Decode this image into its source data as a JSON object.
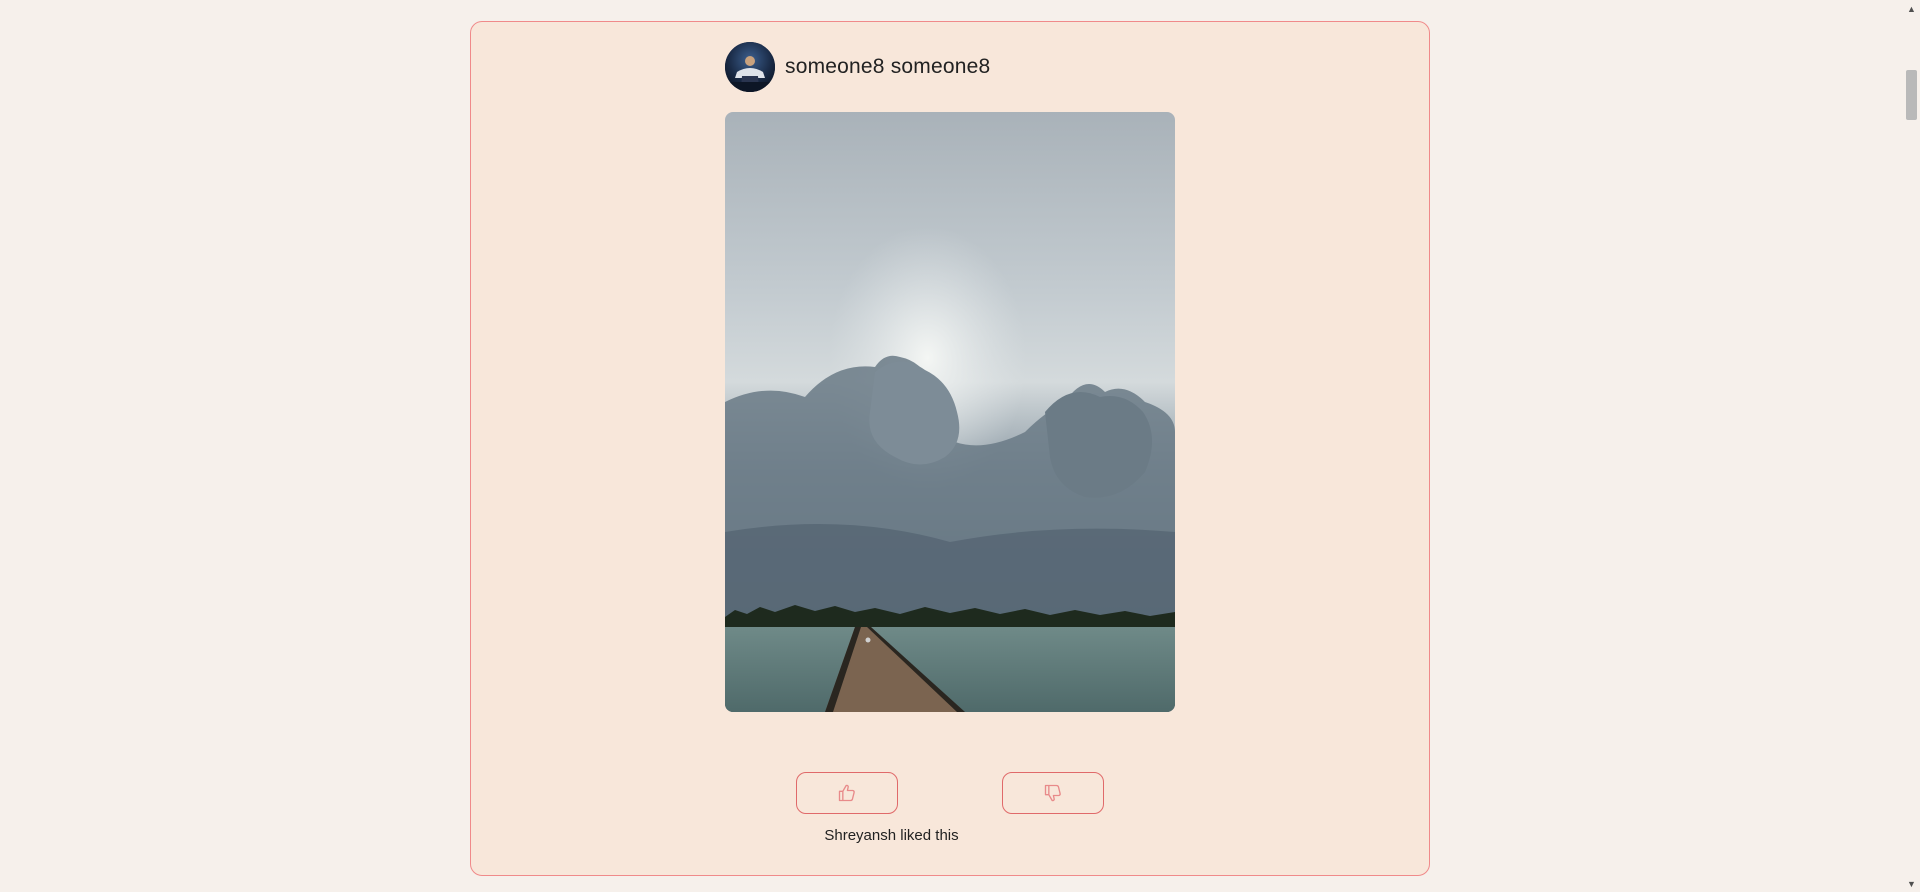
{
  "post": {
    "author": "someone8 someone8",
    "avatar_icon": "user-avatar",
    "photo_icon": "landscape-photo",
    "like_icon": "thumbs-up-icon",
    "dislike_icon": "thumbs-down-icon",
    "liked_by": "Shreyansh liked this"
  },
  "colors": {
    "page_bg": "#f6f0eb",
    "card_bg": "#f8e7da",
    "card_border": "#f08a8a",
    "button_border": "#e06a6a",
    "icon_color": "#e88a8a"
  },
  "scrollbar": {
    "up_icon": "scroll-up-arrow",
    "down_icon": "scroll-down-arrow"
  }
}
